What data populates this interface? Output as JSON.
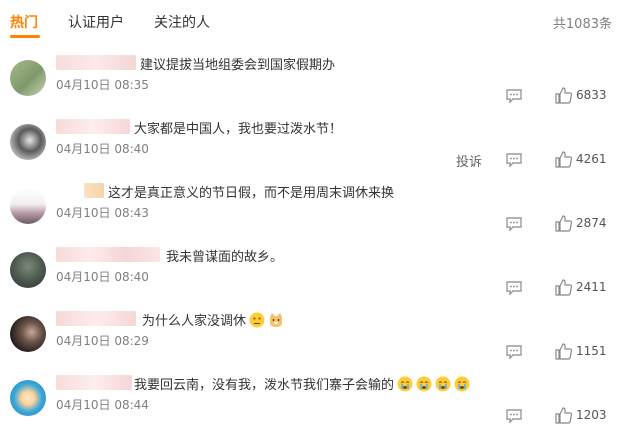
{
  "tabs": [
    {
      "label": "热门"
    },
    {
      "label": "认证用户"
    },
    {
      "label": "关注的人"
    }
  ],
  "total": "共1083条",
  "report_label": "投诉",
  "comments": [
    {
      "text": "建议提拔当地组委会到国家假期办",
      "time": "04月10日 08:35",
      "likes": "6833"
    },
    {
      "text": "大家都是中国人，我也要过泼水节！",
      "time": "04月10日 08:40",
      "likes": "4261"
    },
    {
      "text": "这才是真正意义的节日假，而不是用周末调休来换",
      "time": "04月10日 08:43",
      "likes": "2874"
    },
    {
      "text": "我未曾谋面的故乡。",
      "time": "04月10日 08:40",
      "likes": "2411"
    },
    {
      "text": "为什么人家没调休",
      "time": "04月10日 08:29",
      "likes": "1151"
    },
    {
      "text": "我要回云南，没有我，泼水节我们寨子会输的",
      "time": "04月10日 08:44",
      "likes": "1203"
    }
  ]
}
